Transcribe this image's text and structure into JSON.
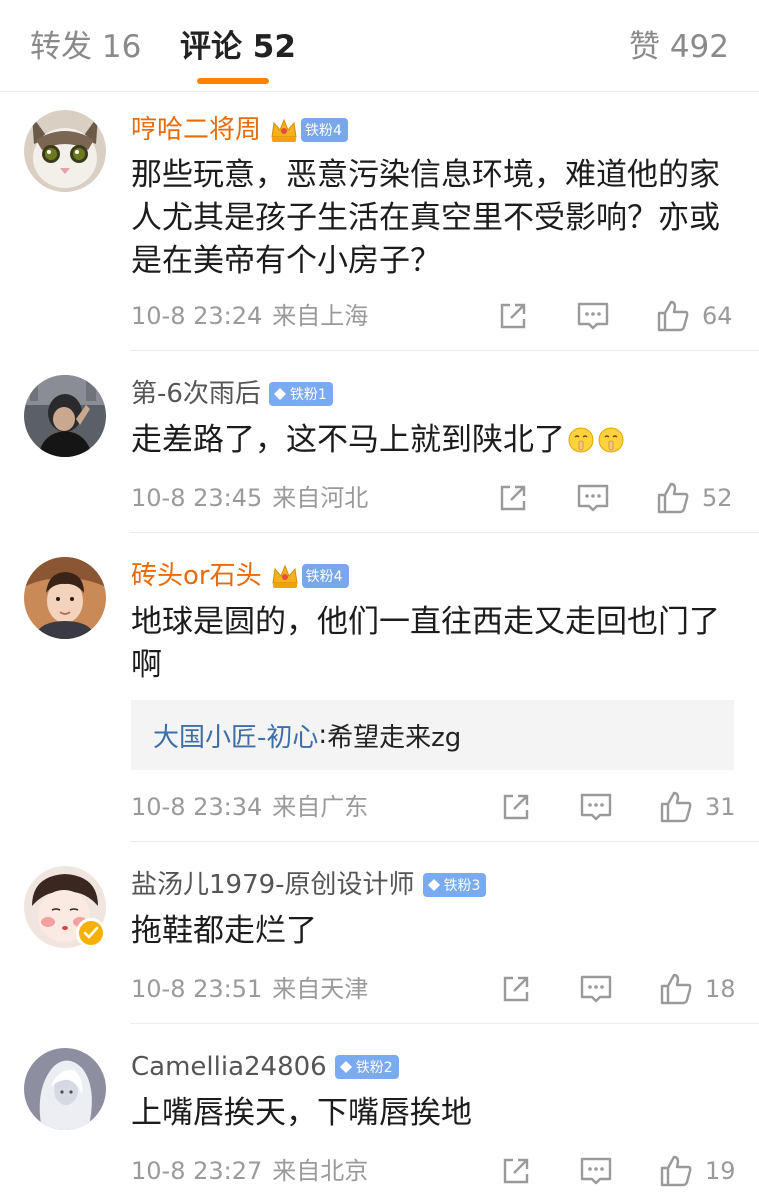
{
  "tabs": {
    "repost_label": "转发 16",
    "comment_label": "评论 52",
    "like_label": "赞 492"
  },
  "colors": {
    "accent": "#ff8200",
    "vip_name": "#e86b0a",
    "reply_user": "#3d6ea8",
    "meta": "#9a9a9a"
  },
  "comments": [
    {
      "username": "哼哈二将周",
      "badge": "铁粉4",
      "content": "那些玩意，恶意污染信息环境，难道他的家人尤其是孩子生活在真空里不受影响？亦或是在美帝有个小房子？",
      "time": "10-8 23:24",
      "location": "来自上海",
      "likes": "64",
      "avatar_icon": "cat-avatar-icon"
    },
    {
      "username": "第-6次雨后",
      "badge": "铁粉1",
      "content": "走差路了，这不马上就到陕北了",
      "time": "10-8 23:45",
      "location": "来自河北",
      "likes": "52",
      "avatar_icon": "person-avatar-icon"
    },
    {
      "username": "砖头or石头",
      "badge": "铁粉4",
      "content": "地球是圆的，他们一直往西走又走回也门了啊",
      "reply": {
        "user": "大国小匠-初心",
        "separator": ": ",
        "text": "希望走来zg"
      },
      "time": "10-8 23:34",
      "location": "来自广东",
      "likes": "31",
      "avatar_icon": "young-man-avatar-icon"
    },
    {
      "username": "盐汤儿1979-原创设计师",
      "badge": "铁粉3",
      "content": "拖鞋都走烂了",
      "time": "10-8 23:51",
      "location": "来自天津",
      "likes": "18",
      "avatar_icon": "cartoon-girl-avatar-icon"
    },
    {
      "username": "Camellia24806",
      "badge": "铁粉2",
      "content": "上嘴唇挨天，下嘴唇挨地",
      "time": "10-8 23:27",
      "location": "来自北京",
      "likes": "19",
      "avatar_icon": "white-hair-avatar-icon"
    }
  ],
  "icons": {
    "share": "share-icon",
    "comment": "comment-icon",
    "like": "thumbs-up-icon",
    "crown": "crown-icon",
    "diamond": "diamond-icon",
    "verified": "verified-icon",
    "emoji": "shush-emoji-icon"
  }
}
